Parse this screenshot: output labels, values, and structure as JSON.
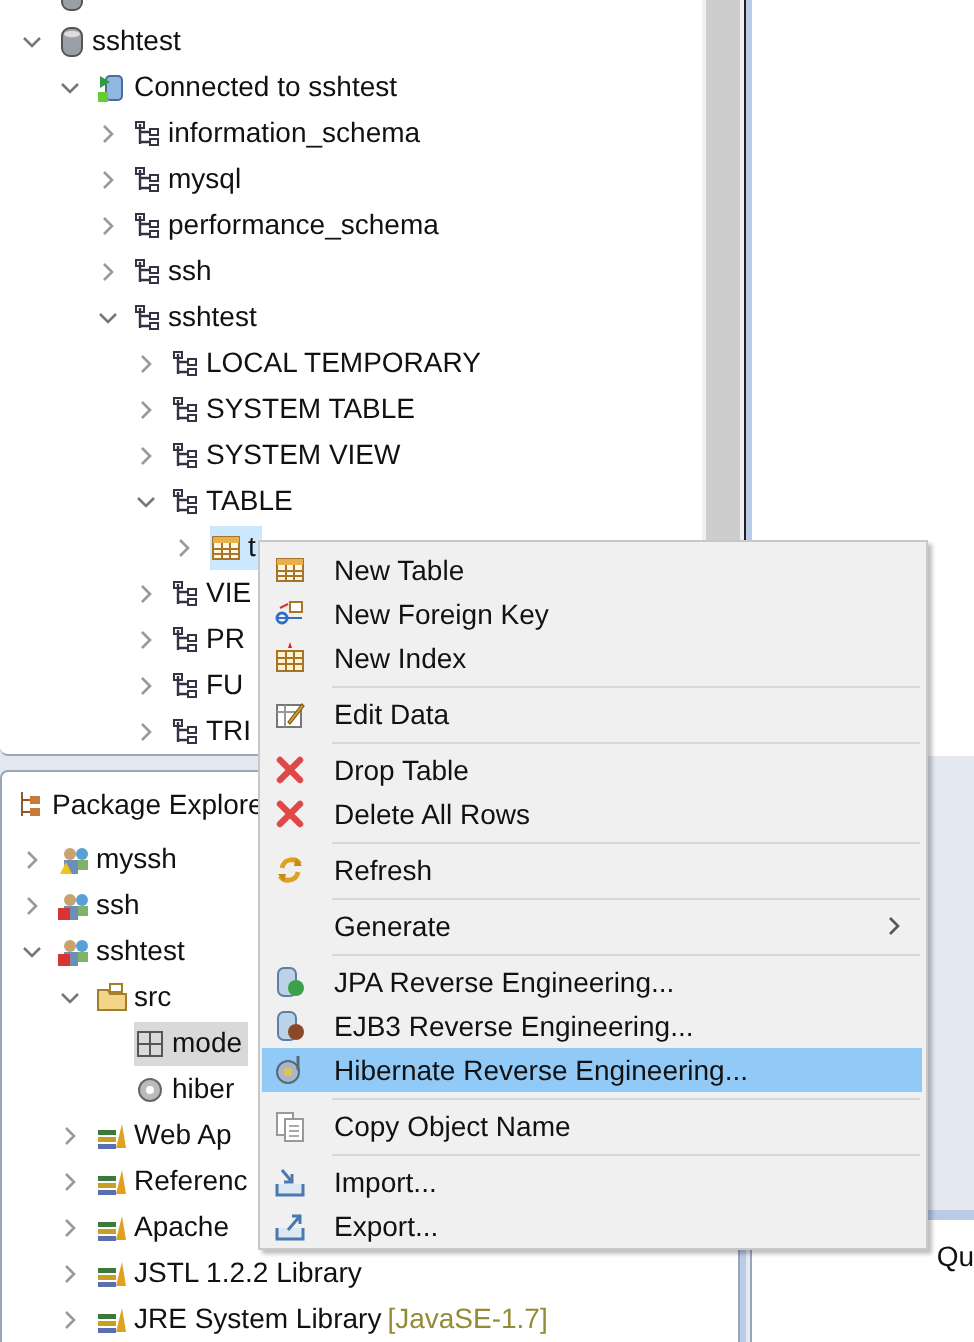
{
  "top_tree": [
    {
      "kind": "database",
      "selected": false
    },
    {
      "label": "sshtest",
      "kind": "database",
      "selected": false,
      "expanded": true,
      "children": [
        {
          "label": "Connected to sshtest",
          "kind": "connection",
          "selected": false,
          "expanded": true,
          "children": [
            {
              "label": "information_schema",
              "kind": "schema",
              "selected": false,
              "expanded": false
            },
            {
              "label": "mysql",
              "kind": "schema",
              "selected": false,
              "expanded": false
            },
            {
              "label": "performance_schema",
              "kind": "schema",
              "selected": false,
              "expanded": false
            },
            {
              "label": "ssh",
              "kind": "schema",
              "selected": false,
              "expanded": false
            },
            {
              "label": "sshtest",
              "kind": "schema",
              "selected": false,
              "expanded": true,
              "children": [
                {
                  "label": "LOCAL TEMPORARY",
                  "kind": "schema",
                  "selected": false,
                  "expanded": false
                },
                {
                  "label": "SYSTEM TABLE",
                  "kind": "schema",
                  "selected": false,
                  "expanded": false
                },
                {
                  "label": "SYSTEM VIEW",
                  "kind": "schema",
                  "selected": false,
                  "expanded": false
                },
                {
                  "label": "TABLE",
                  "kind": "schema",
                  "selected": false,
                  "expanded": true,
                  "children": [
                    {
                      "label": "t",
                      "kind": "table",
                      "selected": true,
                      "expanded": false
                    }
                  ]
                },
                {
                  "label": "VIE",
                  "kind": "schema",
                  "selected": false,
                  "expanded": false
                },
                {
                  "label": "PR",
                  "kind": "schema",
                  "selected": false,
                  "expanded": false
                },
                {
                  "label": "FU",
                  "kind": "schema",
                  "selected": false,
                  "expanded": false
                },
                {
                  "label": "TRI",
                  "kind": "schema",
                  "selected": false,
                  "expanded": false
                }
              ]
            }
          ]
        }
      ]
    }
  ],
  "package_explorer": {
    "title": "Package Explore",
    "tree": [
      {
        "label": "myssh",
        "kind": "project",
        "warning": true,
        "error": false,
        "selected": false,
        "expanded": false
      },
      {
        "label": "ssh",
        "kind": "project",
        "warning": false,
        "error": true,
        "selected": false,
        "expanded": false
      },
      {
        "label": "sshtest",
        "kind": "project",
        "warning": false,
        "error": true,
        "selected": false,
        "expanded": true,
        "children": [
          {
            "label": "src",
            "kind": "source-folder",
            "selected": false,
            "expanded": true,
            "children": [
              {
                "label": "mode",
                "kind": "package",
                "selected": true
              },
              {
                "label": "hiber",
                "kind": "file",
                "selected": false
              }
            ]
          },
          {
            "label": "Web Ap",
            "kind": "library",
            "selected": false,
            "expanded": false
          },
          {
            "label": "Referenc",
            "kind": "library",
            "selected": false,
            "expanded": false
          },
          {
            "label": "Apache",
            "kind": "library",
            "selected": false,
            "expanded": false
          },
          {
            "label": "JSTL 1.2.2 Library",
            "kind": "library",
            "selected": false,
            "expanded": false
          },
          {
            "label": "JRE System Library",
            "suffix": "[JavaSE-1.7]",
            "kind": "library",
            "selected": false,
            "expanded": false
          }
        ]
      }
    ]
  },
  "side_panel": {
    "text": "Qu"
  },
  "context_menu": [
    {
      "kind": "item",
      "label": "New Table",
      "selected": false
    },
    {
      "kind": "item",
      "label": "New Foreign Key",
      "selected": false
    },
    {
      "kind": "item",
      "label": "New Index",
      "selected": false
    },
    {
      "kind": "separator"
    },
    {
      "kind": "item",
      "label": "Edit Data",
      "selected": false
    },
    {
      "kind": "separator"
    },
    {
      "kind": "item",
      "label": "Drop Table",
      "selected": false
    },
    {
      "kind": "item",
      "label": "Delete All Rows",
      "selected": false
    },
    {
      "kind": "separator"
    },
    {
      "kind": "item",
      "label": "Refresh",
      "selected": false
    },
    {
      "kind": "separator"
    },
    {
      "kind": "item",
      "label": "Generate",
      "selected": false,
      "submenu": true
    },
    {
      "kind": "separator"
    },
    {
      "kind": "item",
      "label": "JPA Reverse Engineering...",
      "selected": false
    },
    {
      "kind": "item",
      "label": "EJB3 Reverse Engineering...",
      "selected": false
    },
    {
      "kind": "item",
      "label": "Hibernate Reverse Engineering...",
      "selected": true
    },
    {
      "kind": "separator"
    },
    {
      "kind": "item",
      "label": "Copy Object Name",
      "selected": false
    },
    {
      "kind": "separator"
    },
    {
      "kind": "item",
      "label": "Import...",
      "selected": false
    },
    {
      "kind": "item",
      "label": "Export...",
      "selected": false
    }
  ]
}
